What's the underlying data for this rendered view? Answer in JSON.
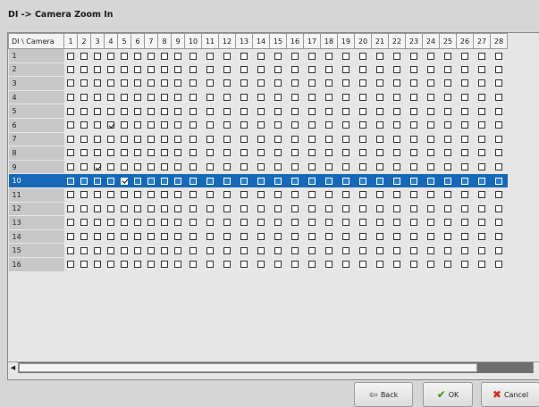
{
  "window": {
    "title": "DI -> Camera Zoom In"
  },
  "grid": {
    "corner_label": "DI \\ Camera",
    "columns": [
      "1",
      "2",
      "3",
      "4",
      "5",
      "6",
      "7",
      "8",
      "9",
      "10",
      "11",
      "12",
      "13",
      "14",
      "15",
      "16",
      "17",
      "18",
      "19",
      "20",
      "21",
      "22",
      "23",
      "24",
      "25",
      "26",
      "27",
      "28"
    ],
    "rows": [
      {
        "label": "1",
        "checked": []
      },
      {
        "label": "2",
        "checked": []
      },
      {
        "label": "3",
        "checked": []
      },
      {
        "label": "4",
        "checked": []
      },
      {
        "label": "5",
        "checked": []
      },
      {
        "label": "6",
        "checked": [
          4
        ]
      },
      {
        "label": "7",
        "checked": []
      },
      {
        "label": "8",
        "checked": []
      },
      {
        "label": "9",
        "checked": [
          3
        ]
      },
      {
        "label": "10",
        "checked": [
          5
        ],
        "selected": true
      },
      {
        "label": "11",
        "checked": []
      },
      {
        "label": "12",
        "checked": []
      },
      {
        "label": "13",
        "checked": []
      },
      {
        "label": "14",
        "checked": []
      },
      {
        "label": "15",
        "checked": []
      },
      {
        "label": "16",
        "checked": []
      }
    ]
  },
  "buttons": {
    "back": "Back",
    "ok": "OK",
    "cancel": "Cancel"
  },
  "icons": {
    "back": "back-arrow-icon",
    "ok": "checkmark-icon",
    "cancel": "cross-icon"
  },
  "colors": {
    "selection": "#1769b8",
    "background": "#d6d6d6"
  }
}
